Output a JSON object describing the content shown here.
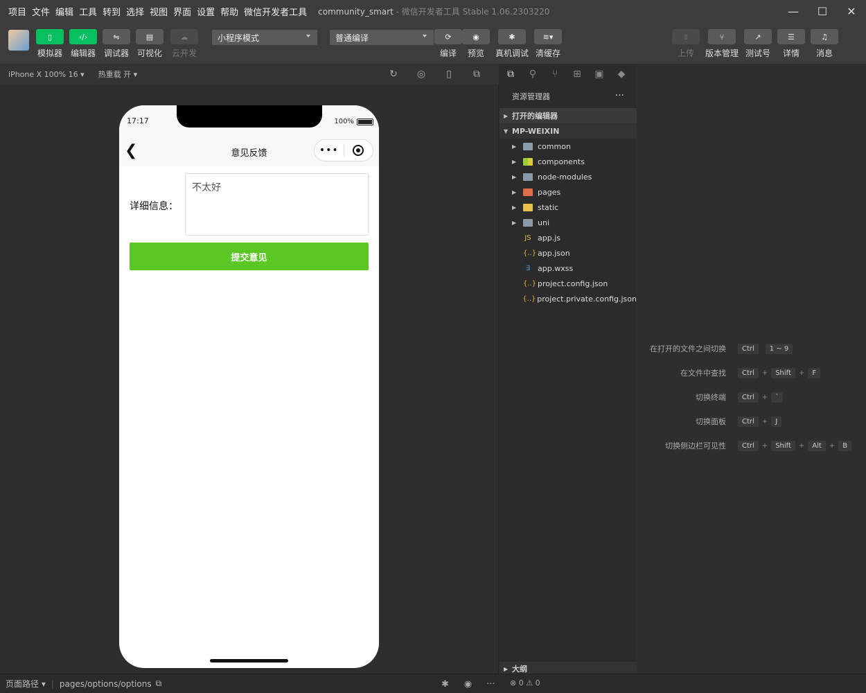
{
  "menubar": {
    "items": [
      "项目",
      "文件",
      "编辑",
      "工具",
      "转到",
      "选择",
      "视图",
      "界面",
      "设置",
      "帮助",
      "微信开发者工具"
    ],
    "project_name": "community_smart",
    "app_name": "- 微信开发者工具 Stable 1.06.2303220",
    "window_controls": [
      "—",
      "☐",
      "✕"
    ]
  },
  "toolbar": {
    "simulator": "模拟器",
    "editor": "编辑器",
    "debugger": "调试器",
    "visual": "可视化",
    "cloud": "云开发",
    "mode_select": "小程序模式",
    "compile_select": "普通编译",
    "compile": "编译",
    "preview": "预览",
    "real_debug": "真机调试",
    "clear_cache": "清缓存",
    "upload": "上传",
    "version": "版本管理",
    "test_account": "测试号",
    "details": "详情",
    "messages": "消息"
  },
  "simbar": {
    "device": "iPhone X 100% 16 ▾",
    "hot_reload": "热重载 开 ▾"
  },
  "phone": {
    "time": "17:17",
    "battery": "100%",
    "nav_title": "意见反馈",
    "back_glyph": "❮",
    "capsule_dots": "•••",
    "form_label": "详细信息：",
    "feedback_value": "不太好",
    "submit_label": "提交意见"
  },
  "explorer": {
    "title": "资源管理器",
    "more": "···",
    "open_editors": "打开的编辑器",
    "project": "MP-WEIXIN",
    "folders": [
      "common",
      "components",
      "node-modules",
      "pages",
      "static",
      "uni"
    ],
    "files": [
      {
        "name": "app.js",
        "glyph": "JS",
        "color": "#e8c04a"
      },
      {
        "name": "app.json",
        "glyph": "{..}",
        "color": "#e8b030"
      },
      {
        "name": "app.wxss",
        "glyph": "∃",
        "color": "#4a9be8"
      },
      {
        "name": "project.config.json",
        "glyph": "{..}",
        "color": "#e8b030"
      },
      {
        "name": "project.private.config.json",
        "glyph": "{..}",
        "color": "#e8b030"
      }
    ],
    "outline": "大纲"
  },
  "shortcuts": [
    {
      "label": "在打开的文件之间切换",
      "keys": [
        "Ctrl",
        "1 ~ 9"
      ]
    },
    {
      "label": "在文件中查找",
      "keys": [
        "Ctrl",
        "Shift",
        "F"
      ]
    },
    {
      "label": "切换终端",
      "keys": [
        "Ctrl",
        "`"
      ]
    },
    {
      "label": "切换面板",
      "keys": [
        "Ctrl",
        "J"
      ]
    },
    {
      "label": "切换侧边栏可见性",
      "keys": [
        "Ctrl",
        "Shift",
        "Alt",
        "B"
      ]
    }
  ],
  "statusbar": {
    "page_path_label": "页面路径 ▾",
    "page_path": "pages/options/options",
    "problems": "⊗ 0 ⚠ 0"
  }
}
